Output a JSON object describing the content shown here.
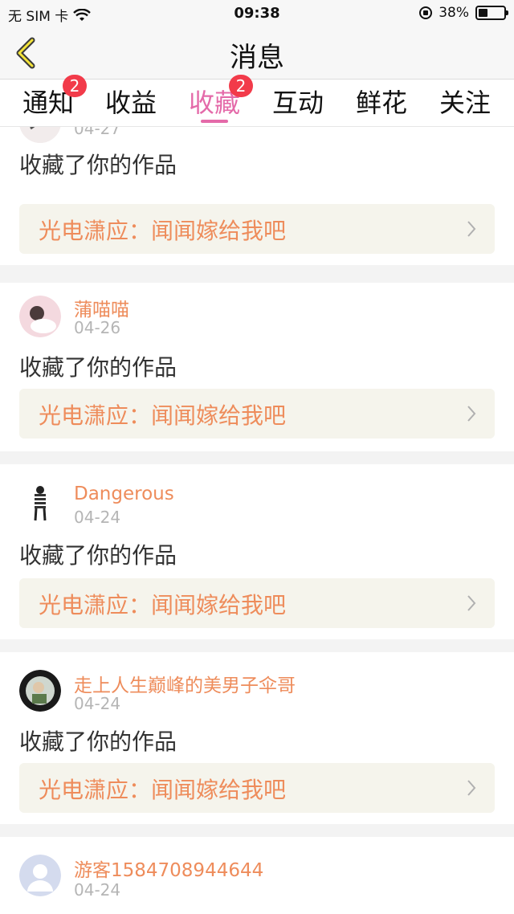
{
  "status_bar": {
    "carrier": "无 SIM 卡",
    "time": "09:38",
    "battery": "38%",
    "battery_level": 0.38
  },
  "nav": {
    "title": "消息",
    "back_icon": "chevron-left-icon"
  },
  "tabs": [
    {
      "label": "通知",
      "badge": "2"
    },
    {
      "label": "收益",
      "badge": ""
    },
    {
      "label": "收藏",
      "badge": "2"
    },
    {
      "label": "互动",
      "badge": ""
    },
    {
      "label": "鲜花",
      "badge": ""
    },
    {
      "label": "关注",
      "badge": ""
    }
  ],
  "active_tab": "收藏",
  "colors": {
    "accent": "#e46aa9",
    "orange": "#ee8c5b",
    "badge": "#f23b4a",
    "card_link_bg": "#f5f4ec"
  },
  "feed": [
    {
      "username": "",
      "date": "04-27",
      "action": "收藏了你的作品",
      "work": "光电潇应：闻闻嫁给我吧"
    },
    {
      "username": "蒲喵喵",
      "date": "04-26",
      "action": "收藏了你的作品",
      "work": "光电潇应：闻闻嫁给我吧"
    },
    {
      "username": "Dangerous",
      "date": "04-24",
      "action": "收藏了你的作品",
      "work": "光电潇应：闻闻嫁给我吧"
    },
    {
      "username": "走上人生巅峰的美男子伞哥",
      "date": "04-24",
      "action": "收藏了你的作品",
      "work": "光电潇应：闻闻嫁给我吧"
    },
    {
      "username": "游客1584708944644",
      "date": "04-24",
      "action": "",
      "work": ""
    }
  ]
}
